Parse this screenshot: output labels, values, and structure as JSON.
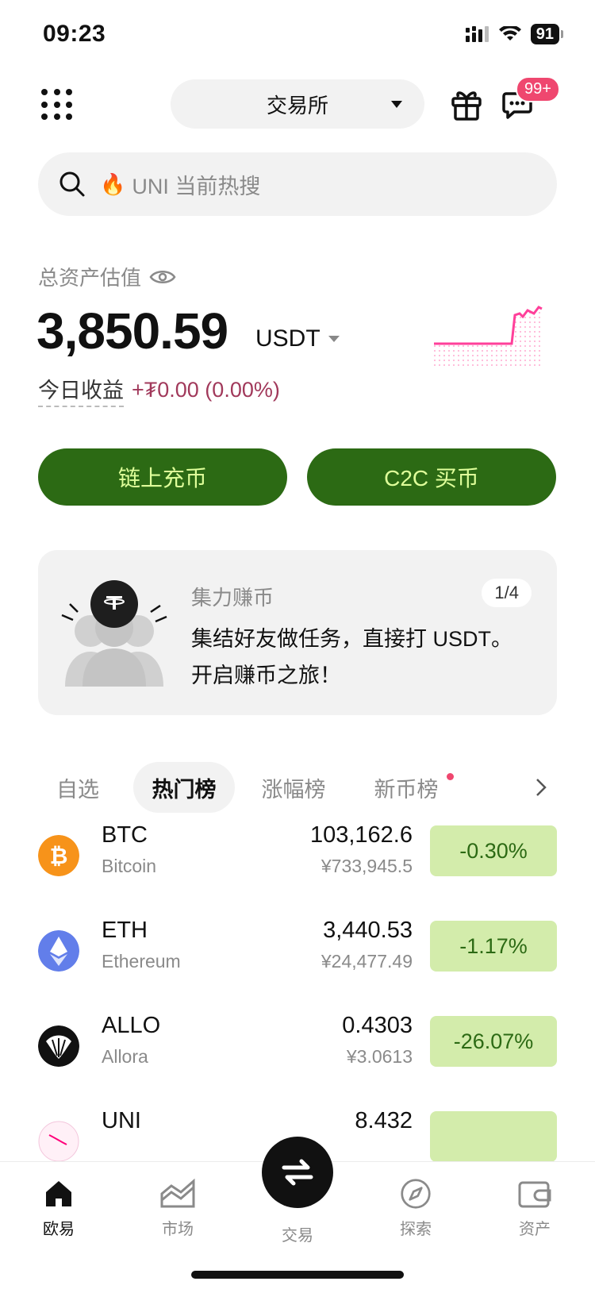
{
  "status_bar": {
    "time": "09:23",
    "battery": "91"
  },
  "header": {
    "exchange_label": "交易所",
    "badge": "99+"
  },
  "search": {
    "placeholder": "UNI 当前热搜"
  },
  "assets": {
    "label": "总资产估值",
    "value": "3,850.59",
    "unit": "USDT",
    "today_label": "今日收益",
    "today_value": "+₮0.00 (0.00%)",
    "accent_color": "#ff3f9a"
  },
  "actions": {
    "deposit": "链上充币",
    "c2c": "C2C 买币",
    "button_color": "#2c6a14",
    "button_text_color": "#dfff9a"
  },
  "promo": {
    "title": "集力赚币",
    "page": "1/4",
    "line1": "集结好友做任务，直接打 USDT。",
    "line2": "开启赚币之旅！"
  },
  "tabs": [
    {
      "label": "自选",
      "active": false
    },
    {
      "label": "热门榜",
      "active": true
    },
    {
      "label": "涨幅榜",
      "active": false
    },
    {
      "label": "新币榜",
      "active": false,
      "dot": true
    }
  ],
  "coins": [
    {
      "symbol": "BTC",
      "name": "Bitcoin",
      "price": "103,162.6",
      "cny": "¥733,945.5",
      "change": "-0.30%",
      "logo_color": "#f7931a",
      "icon": "bitcoin-icon"
    },
    {
      "symbol": "ETH",
      "name": "Ethereum",
      "price": "3,440.53",
      "cny": "¥24,477.49",
      "change": "-1.17%",
      "logo_color": "#627eea",
      "icon": "ethereum-icon"
    },
    {
      "symbol": "ALLO",
      "name": "Allora",
      "price": "0.4303",
      "cny": "¥3.0613",
      "change": "-26.07%",
      "logo_color": "#111111",
      "icon": "allora-icon"
    },
    {
      "symbol": "UNI",
      "name": "",
      "price": "8.432",
      "cny": "",
      "change": "",
      "logo_color": "#ff007a",
      "icon": "uniswap-icon"
    }
  ],
  "change_bg": "#d3ecab",
  "change_text": "#2c6a14",
  "bottom_nav": {
    "home": "欧易",
    "market": "市场",
    "trade": "交易",
    "discover": "探索",
    "assets": "资产"
  }
}
